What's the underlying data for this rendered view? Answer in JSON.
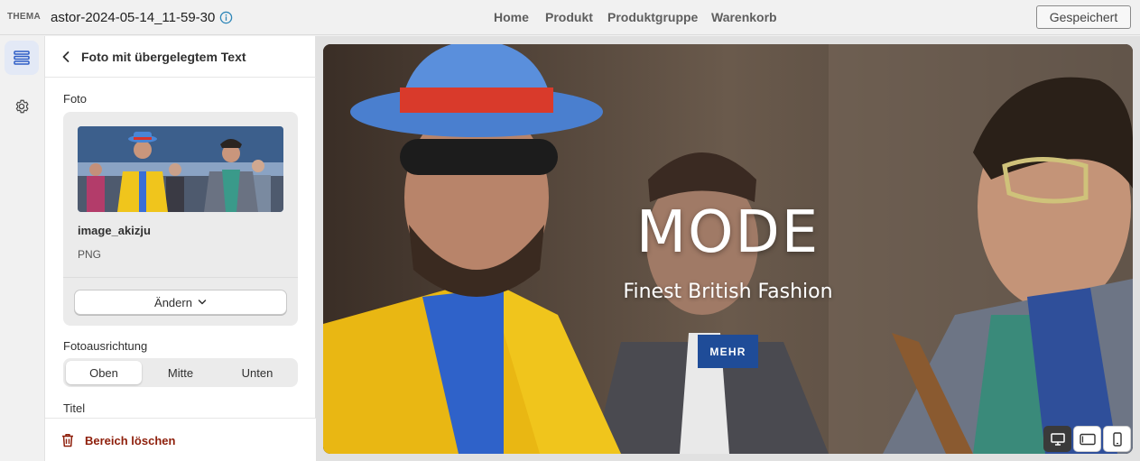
{
  "topbar": {
    "theme_label": "THEMA",
    "theme_name": "astor-2024-05-14_11-59-30",
    "nav": [
      "Home",
      "Produkt",
      "Produktgruppe",
      "Warenkorb"
    ],
    "save_label": "Gespeichert"
  },
  "rail": {
    "items": [
      {
        "icon": "sections-icon",
        "active": true
      },
      {
        "icon": "gear-icon",
        "active": false
      }
    ]
  },
  "panel": {
    "title": "Foto mit übergelegtem Text",
    "photo_label": "Foto",
    "file_name": "image_akizju",
    "file_type": "PNG",
    "change_label": "Ändern",
    "orientation_label": "Fotoausrichtung",
    "orientation_options": [
      "Oben",
      "Mitte",
      "Unten"
    ],
    "orientation_selected": "Oben",
    "title_label": "Titel",
    "delete_label": "Bereich löschen"
  },
  "preview": {
    "heading": "MODE",
    "subheading": "Finest British Fashion",
    "button_label": "MEHR",
    "button_color": "#1f4c98"
  },
  "viewport": {
    "options": [
      "desktop-icon",
      "tablet-icon",
      "mobile-icon"
    ],
    "selected": "desktop-icon"
  },
  "colors": {
    "accent_active_rail": "#e3e9f6",
    "delete_red": "#8e1f0b"
  }
}
